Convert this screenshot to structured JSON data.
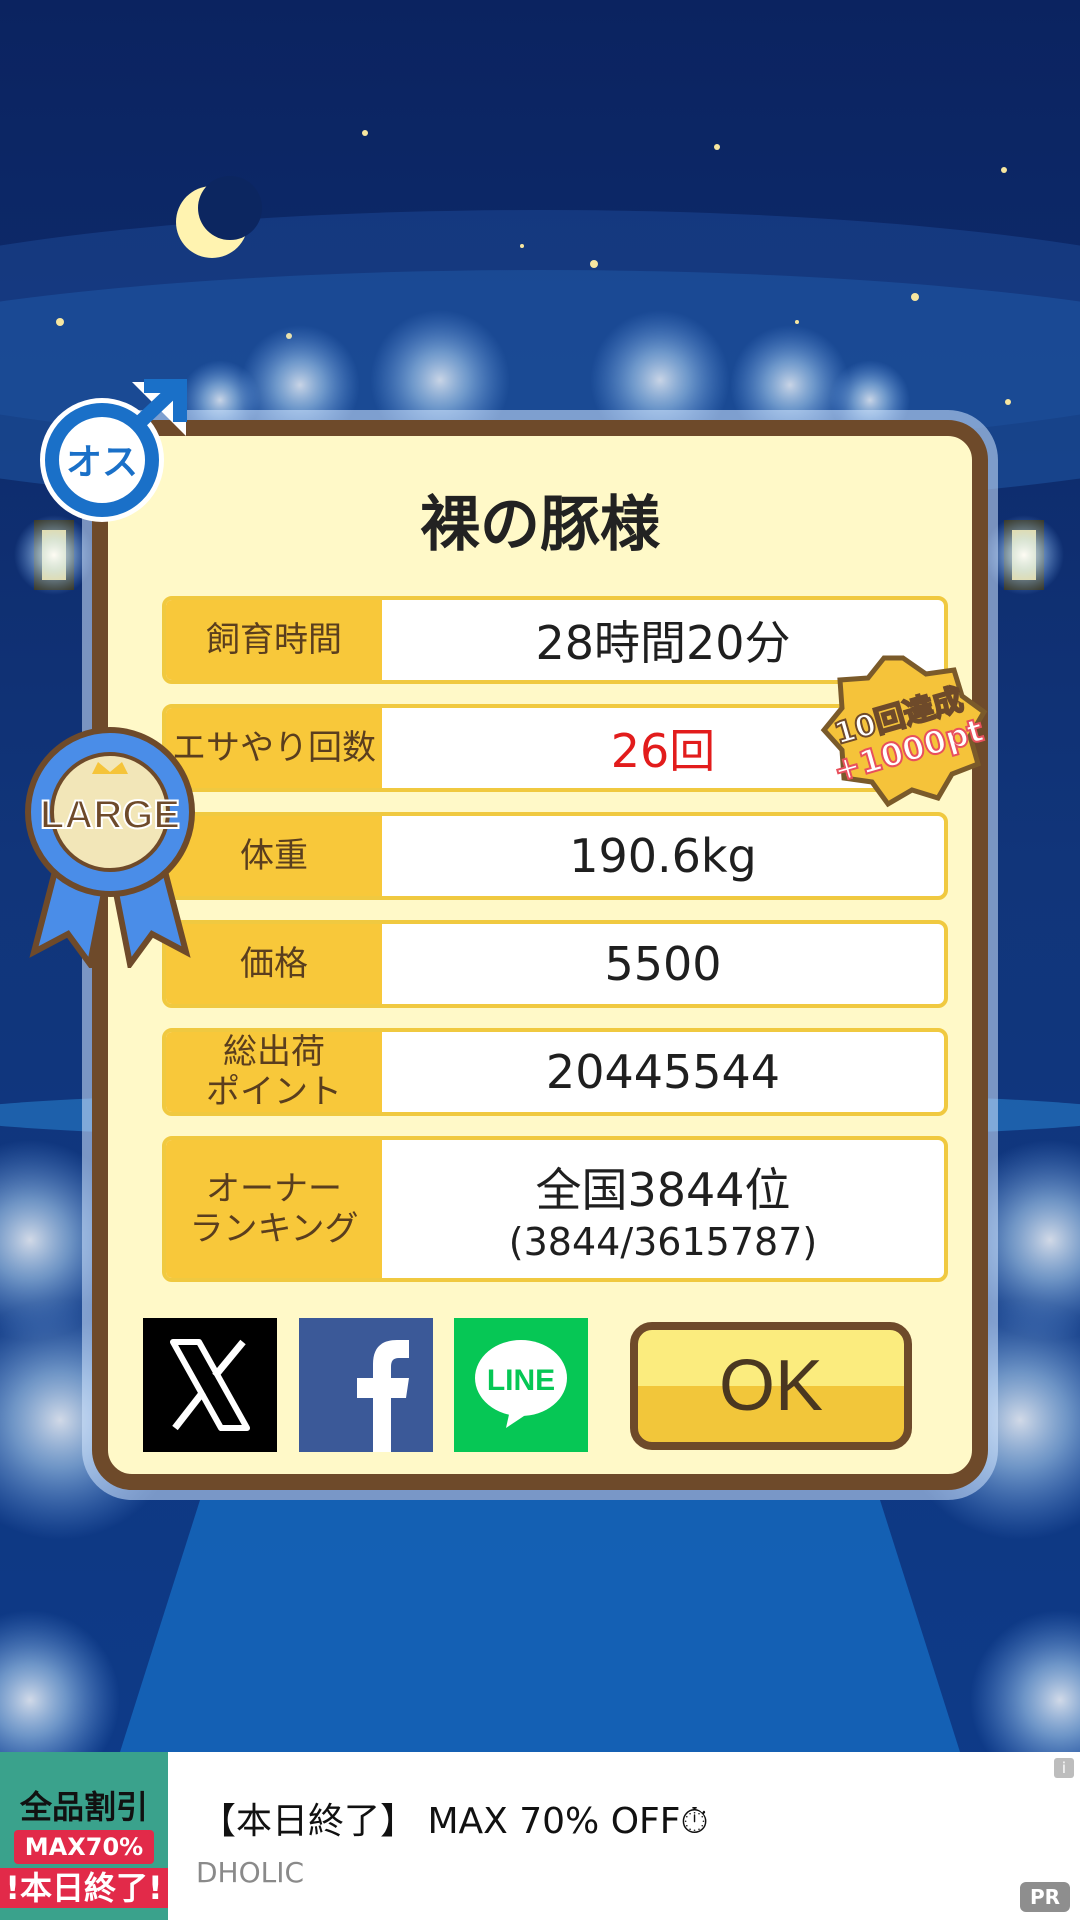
{
  "dialog": {
    "title": "裸の豚様",
    "rows": [
      {
        "label": "飼育時間",
        "value": "28時間20分"
      },
      {
        "label": "エサやり回数",
        "value": "26回"
      },
      {
        "label": "体重",
        "value": "190.6kg"
      },
      {
        "label": "価格",
        "value": "5500"
      },
      {
        "label": "総出荷\nポイント",
        "value": "20445544"
      },
      {
        "label": "オーナー\nランキング",
        "value": "全国3844位",
        "subvalue": "(3844/3615787)"
      }
    ],
    "ok_label": "OK"
  },
  "badges": {
    "gender_text": "オス",
    "size_text": "LARGE",
    "bonus_line1": "10回達成",
    "bonus_line2": "+1000pt"
  },
  "share": {
    "x_icon": "x-logo-icon",
    "facebook_icon": "facebook-logo-icon",
    "line_icon": "line-logo-icon",
    "line_text": "LINE"
  },
  "ad": {
    "thumb_line1": "全品割引",
    "thumb_line2": "MAX70%",
    "thumb_line3": "!本日終了!",
    "title": "【本日終了】 MAX 70% OFF⏱",
    "sponsor": "DHOLIC",
    "info_label": "i",
    "pr_label": "PR"
  },
  "colors": {
    "sky_top": "#0e2a66",
    "card_bg": "#fff9c8",
    "card_border": "#6e4a2a",
    "label_bg": "#f8c83a",
    "highlight_red": "#e21c1c",
    "gender_blue": "#1a70c8"
  }
}
